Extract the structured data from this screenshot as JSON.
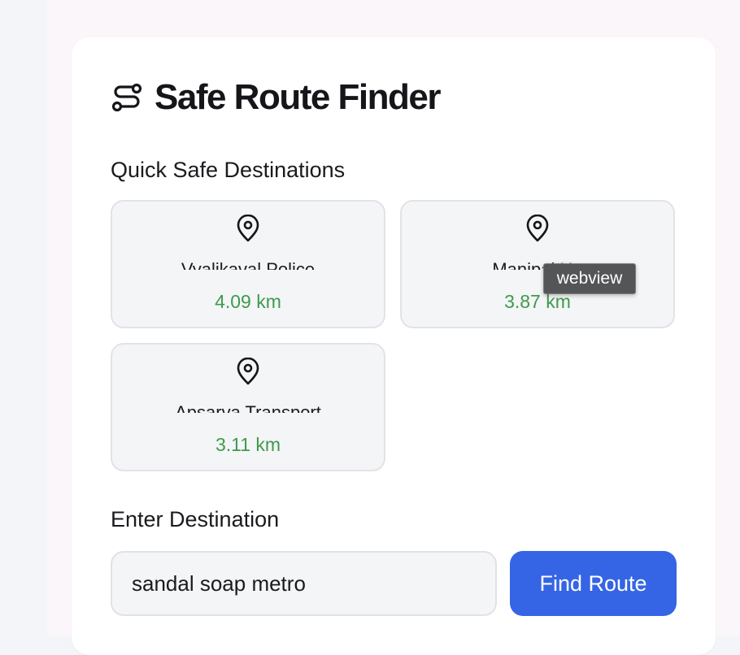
{
  "app": {
    "title": "Safe Route Finder"
  },
  "quick_destinations": {
    "label": "Quick Safe Destinations",
    "items": [
      {
        "name": "Vyalikaval Police",
        "distance": "4.09 km"
      },
      {
        "name": "Manipal Ho",
        "distance": "3.87 km"
      },
      {
        "name": "Apsarva Transport",
        "distance": "3.11 km"
      }
    ]
  },
  "tooltip": {
    "text": "webview"
  },
  "destination": {
    "label": "Enter Destination",
    "value": "sandal soap metro"
  },
  "find_button": {
    "label": "Find Route"
  },
  "colors": {
    "accent": "#3565e5",
    "distance": "#3e9a4c",
    "card_bg": "#f4f5f7"
  },
  "icons": {
    "title": "route-icon",
    "destination": "map-pin-icon"
  }
}
